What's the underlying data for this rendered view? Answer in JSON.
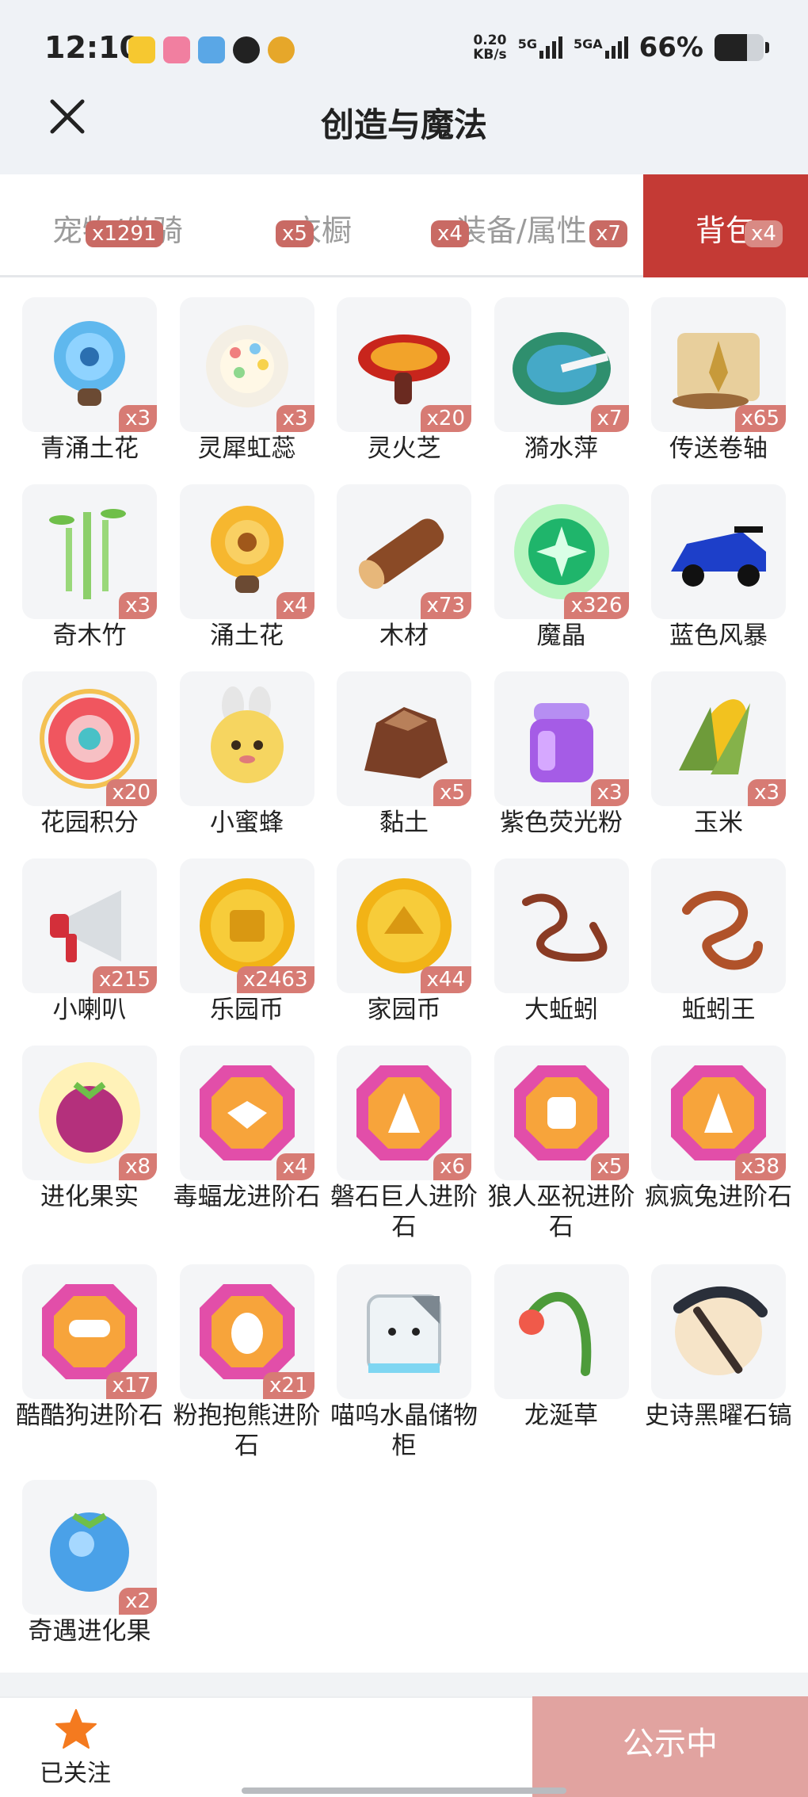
{
  "status_bar": {
    "time": "12:10",
    "app_icons": [
      "meituan-icon",
      "bilibili-icon",
      "paper-plane-icon",
      "qq-penguin-icon",
      "music-target-icon"
    ],
    "net_speed_value": "0.20",
    "net_speed_unit": "KB/s",
    "sim1_label": "5G",
    "sim2_label": "5GA",
    "battery_text": "66%",
    "battery_level": 0.66
  },
  "header": {
    "title": "创造与魔法"
  },
  "tabs": [
    {
      "label": "宠物/坐骑",
      "count": "x1291",
      "active": false
    },
    {
      "label": "衣橱",
      "count": "x5",
      "active": false
    },
    {
      "label": "装备/属性",
      "count": "x4",
      "active": false
    },
    {
      "label": "",
      "count": "x7",
      "active": false
    },
    {
      "label": "背包",
      "count": "x4",
      "active": true
    }
  ],
  "items": [
    {
      "name": "青涌土花",
      "qty": "x3",
      "icon": "blue-flower-icon"
    },
    {
      "name": "灵犀虹蕊",
      "qty": "x3",
      "icon": "rainbow-stamen-flower-icon"
    },
    {
      "name": "灵火芝",
      "qty": "x20",
      "icon": "fire-mushroom-icon"
    },
    {
      "name": "漪水萍",
      "qty": "x7",
      "icon": "lily-pad-icon"
    },
    {
      "name": "传送卷轴",
      "qty": "x65",
      "icon": "teleport-scroll-icon"
    },
    {
      "name": "奇木竹",
      "qty": "x3",
      "icon": "bamboo-icon"
    },
    {
      "name": "涌土花",
      "qty": "x4",
      "icon": "yellow-flower-icon"
    },
    {
      "name": "木材",
      "qty": "x73",
      "icon": "wood-log-icon"
    },
    {
      "name": "魔晶",
      "qty": "x326",
      "icon": "magic-crystal-icon"
    },
    {
      "name": "蓝色风暴",
      "qty": "",
      "icon": "blue-race-car-icon"
    },
    {
      "name": "花园积分",
      "qty": "x20",
      "icon": "garden-points-flower-icon"
    },
    {
      "name": "小蜜蜂",
      "qty": "",
      "icon": "little-bee-icon"
    },
    {
      "name": "黏土",
      "qty": "x5",
      "icon": "clay-rock-icon"
    },
    {
      "name": "紫色荧光粉",
      "qty": "x3",
      "icon": "purple-powder-jar-icon"
    },
    {
      "name": "玉米",
      "qty": "x3",
      "icon": "corn-icon"
    },
    {
      "name": "小喇叭",
      "qty": "x215",
      "icon": "megaphone-icon"
    },
    {
      "name": "乐园币",
      "qty": "x2463",
      "icon": "paradise-coin-icon"
    },
    {
      "name": "家园币",
      "qty": "x44",
      "icon": "home-coin-icon"
    },
    {
      "name": "大蚯蚓",
      "qty": "",
      "icon": "big-earthworm-icon"
    },
    {
      "name": "蚯蚓王",
      "qty": "",
      "icon": "earthworm-king-icon"
    },
    {
      "name": "进化果实",
      "qty": "x8",
      "icon": "evolution-berry-icon"
    },
    {
      "name": "毒蝠龙进阶石",
      "qty": "x4",
      "icon": "bat-dragon-gem-icon"
    },
    {
      "name": "磐石巨人进阶石",
      "qty": "x6",
      "icon": "rock-giant-gem-icon"
    },
    {
      "name": "狼人巫祝进阶石",
      "qty": "x5",
      "icon": "werewolf-gem-icon"
    },
    {
      "name": "疯疯兔进阶石",
      "qty": "x38",
      "icon": "crazy-rabbit-gem-icon"
    },
    {
      "name": "酷酷狗进阶石",
      "qty": "x17",
      "icon": "cool-dog-gem-icon"
    },
    {
      "name": "粉抱抱熊进阶石",
      "qty": "x21",
      "icon": "pink-bear-gem-icon"
    },
    {
      "name": "喵呜水晶储物柜",
      "qty": "",
      "icon": "cat-crystal-cabinet-icon"
    },
    {
      "name": "龙涎草",
      "qty": "",
      "icon": "dragon-grass-icon"
    },
    {
      "name": "史诗黑曜石镐",
      "qty": "",
      "icon": "obsidian-pickaxe-icon"
    },
    {
      "name": "奇遇进化果",
      "qty": "x2",
      "icon": "blue-evolution-berry-icon"
    }
  ],
  "footer": {
    "follow_label": "已关注",
    "follow_icon": "star-icon",
    "public_label": "公示中"
  },
  "colors": {
    "active_tab": "#c43a35",
    "badge": "#d77b74",
    "public_button": "#e1a3a0",
    "star": "#f47a1f"
  }
}
